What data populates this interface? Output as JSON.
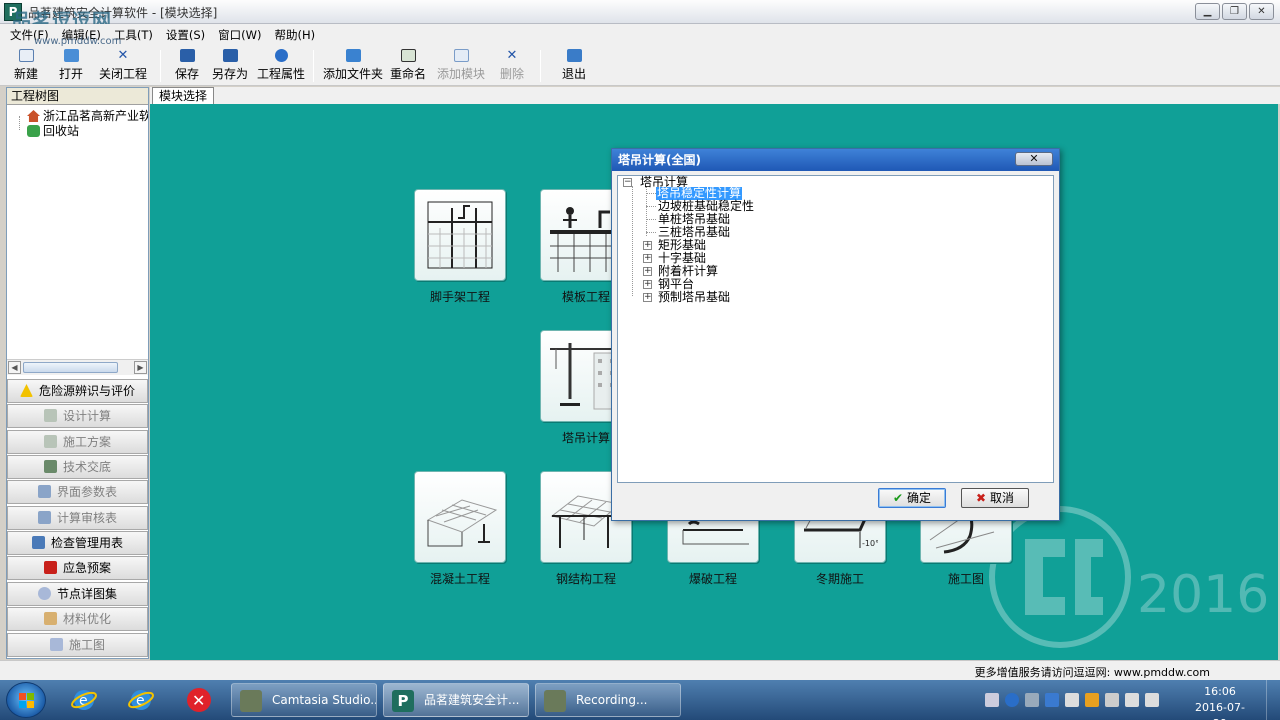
{
  "window": {
    "title": "品茗建筑安全计算软件 - [模块选择]",
    "logo_text": "品茗逗逗网",
    "logo_url": "www.pmddw.com"
  },
  "menu": [
    "文件(F)",
    "编辑(E)",
    "工具(T)",
    "设置(S)",
    "窗口(W)",
    "帮助(H)"
  ],
  "toolbar": [
    {
      "label": "新建",
      "icon": "new-file-icon"
    },
    {
      "label": "打开",
      "icon": "open-folder-icon"
    },
    {
      "label": "关闭工程",
      "icon": "close-x-icon"
    },
    {
      "label": "保存",
      "icon": "save-icon"
    },
    {
      "label": "另存为",
      "icon": "save-as-icon"
    },
    {
      "label": "工程属性",
      "icon": "info-icon"
    },
    {
      "label": "添加文件夹",
      "icon": "add-folder-icon"
    },
    {
      "label": "重命名",
      "icon": "rename-icon"
    },
    {
      "label": "添加模块",
      "icon": "add-module-icon",
      "disabled": true
    },
    {
      "label": "删除",
      "icon": "delete-icon",
      "disabled": true
    },
    {
      "label": "退出",
      "icon": "exit-icon"
    }
  ],
  "left_panel": {
    "header": "工程树图",
    "tree": [
      {
        "label": "浙江品茗高新产业软件",
        "icon": "house-icon"
      },
      {
        "label": "回收站",
        "icon": "recycle-bin-icon"
      }
    ],
    "buttons": [
      {
        "label": "危险源辨识与评价",
        "icon": "warning-icon",
        "state": "active"
      },
      {
        "label": "设计计算",
        "icon": "calc-icon",
        "state": "dim"
      },
      {
        "label": "施工方案",
        "icon": "plan-icon",
        "state": "dim"
      },
      {
        "label": "技术交底",
        "icon": "tech-icon",
        "state": "dim"
      },
      {
        "label": "界面参数表",
        "icon": "table-icon",
        "state": "dim"
      },
      {
        "label": "计算审核表",
        "icon": "review-icon",
        "state": "dim"
      },
      {
        "label": "检查管理用表",
        "icon": "check-icon",
        "state": "active"
      },
      {
        "label": "应急预案",
        "icon": "emergency-icon",
        "state": "active"
      },
      {
        "label": "节点详图集",
        "icon": "detail-icon",
        "state": "active"
      },
      {
        "label": "材料优化",
        "icon": "material-icon",
        "state": "dim"
      },
      {
        "label": "施工图",
        "icon": "drawing-icon",
        "state": "dim"
      }
    ]
  },
  "tabs": [
    {
      "label": "模块选择"
    }
  ],
  "modules": [
    {
      "label": "脚手架工程",
      "icon": "scaffold-icon"
    },
    {
      "label": "模板工程",
      "icon": "formwork-icon"
    },
    {
      "label": "塔吊计算",
      "icon": "tower-crane-icon"
    },
    {
      "label": "混凝土工程",
      "icon": "concrete-icon"
    },
    {
      "label": "钢结构工程",
      "icon": "steel-structure-icon"
    },
    {
      "label": "爆破工程",
      "icon": "blasting-icon"
    },
    {
      "label": "冬期施工",
      "icon": "winter-icon",
      "extra": "-10°C"
    },
    {
      "label": "施工图",
      "icon": "construction-drawing-icon"
    }
  ],
  "watermark": {
    "year": "2016"
  },
  "dialog": {
    "title": "塔吊计算(全国)",
    "close_label": "✕",
    "root": "塔吊计算",
    "items": [
      {
        "label": "塔吊稳定性计算",
        "selected": true,
        "expandable": false
      },
      {
        "label": "边坡桩基础稳定性",
        "expandable": false
      },
      {
        "label": "单桩塔吊基础",
        "expandable": false
      },
      {
        "label": "三桩塔吊基础",
        "expandable": false
      },
      {
        "label": "矩形基础",
        "expandable": true
      },
      {
        "label": "十字基础",
        "expandable": true
      },
      {
        "label": "附着杆计算",
        "expandable": true
      },
      {
        "label": "钢平台",
        "expandable": true
      },
      {
        "label": "预制塔吊基础",
        "expandable": true
      }
    ],
    "ok_label": "确定",
    "cancel_label": "取消"
  },
  "statusbar": {
    "message": "更多增值服务请访问逗逗网: www.pmddw.com"
  },
  "taskbar": {
    "tasks": [
      {
        "label": "Camtasia Studio..."
      },
      {
        "label": "品茗建筑安全计..."
      },
      {
        "label": "Recording..."
      }
    ],
    "time": "16:06",
    "date": "2016-07-29"
  }
}
